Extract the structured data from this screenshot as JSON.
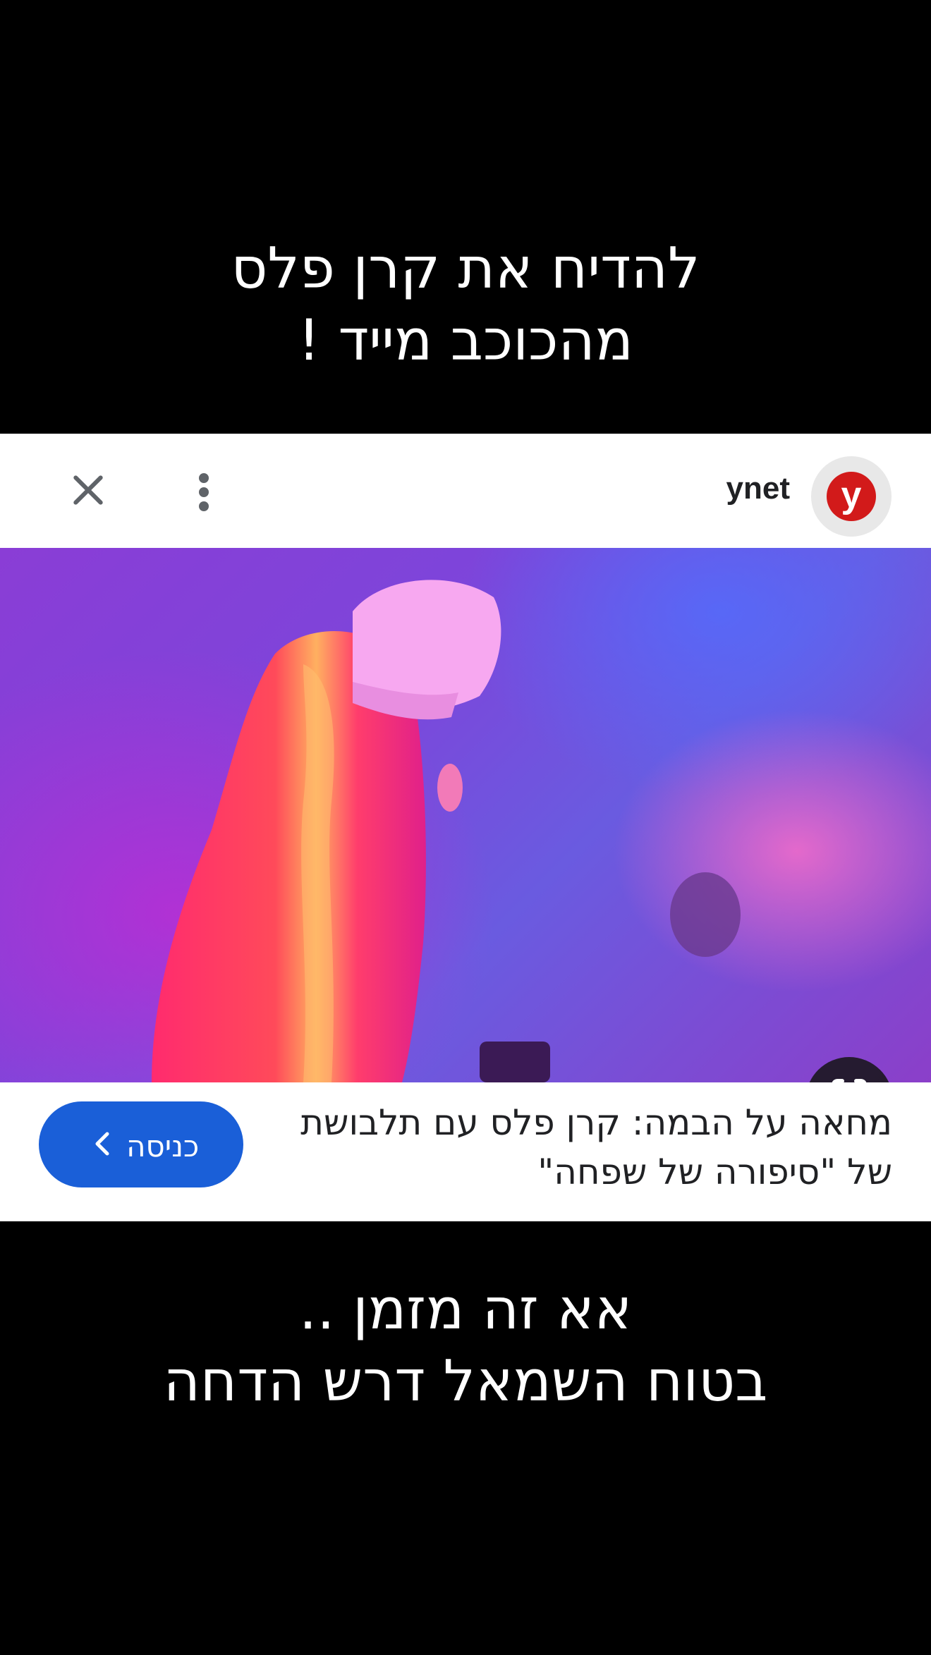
{
  "top_caption": {
    "line1": "להדיח את קרן פלס",
    "line2": "מהכוכב מייד !"
  },
  "card": {
    "header": {
      "brand_name": "ynet",
      "brand_logo_letter": "y",
      "brand_color": "#d21a1a",
      "icons": [
        "close-icon",
        "more-vertical-icon"
      ]
    },
    "image": {
      "lens_icon": "lens-search-icon"
    },
    "headline": {
      "line1": "מחאה על הבמה: קרן פלס עם תלבושת",
      "line2": "של \"סיפורה של שפחה\""
    },
    "enter_button": {
      "label": "כניסה",
      "icon": "chevron-left-icon",
      "color": "#1a5fd8"
    }
  },
  "bottom_caption": {
    "line1": "אא זה מזמן ..",
    "line2": "בטוח השמאל דרש הדחה"
  }
}
